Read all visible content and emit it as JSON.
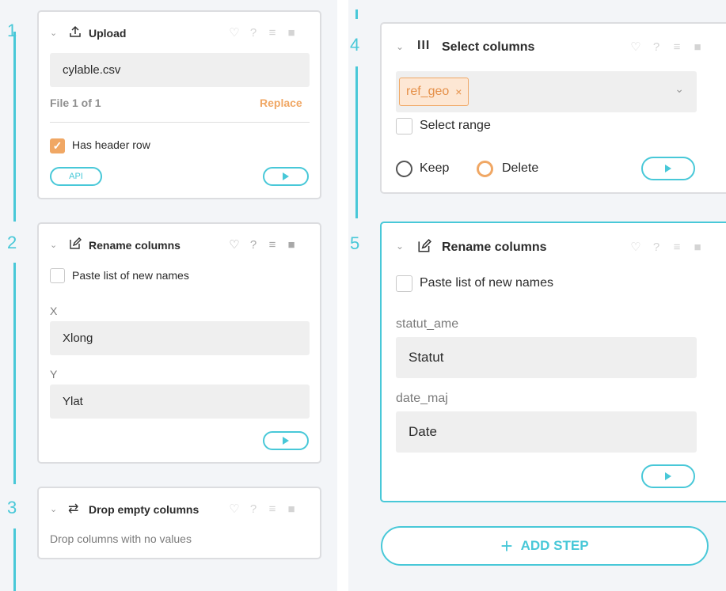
{
  "steps": {
    "upload": {
      "number": "1",
      "title": "Upload",
      "filename": "cylable.csv",
      "file_count": "File 1 of 1",
      "replace_label": "Replace",
      "header_row_label": "Has header row",
      "header_row_checked": true,
      "api_label": "API"
    },
    "rename_left": {
      "number": "2",
      "title": "Rename columns",
      "paste_label": "Paste list of new names",
      "fields": [
        {
          "column": "X",
          "value": "Xlong"
        },
        {
          "column": "Y",
          "value": "Ylat"
        }
      ]
    },
    "drop_empty": {
      "number": "3",
      "title": "Drop empty columns",
      "description": "Drop columns with no values"
    },
    "select_columns": {
      "number": "4",
      "title": "Select columns",
      "selected_tag": "ref_geo",
      "tag_remove": "×",
      "select_range_label": "Select range",
      "keep_label": "Keep",
      "delete_label": "Delete",
      "selected_mode": "Delete"
    },
    "rename_right": {
      "number": "5",
      "title": "Rename columns",
      "paste_label": "Paste list of new names",
      "fields": [
        {
          "column": "statut_ame",
          "value": "Statut"
        },
        {
          "column": "date_maj",
          "value": "Date"
        }
      ]
    }
  },
  "add_step_label": "ADD STEP",
  "icons": {
    "chevron": "chevron-down-icon",
    "upload": "upload-icon",
    "rename": "edit-icon",
    "drop": "swap-arrows-icon",
    "select": "columns-icon",
    "bell": "bell-icon",
    "help": "help-icon",
    "add_note": "add-note-icon",
    "delete": "trash-icon",
    "play": "play-icon"
  },
  "colors": {
    "accent": "#48c8d8",
    "orange": "#f0a764",
    "panel_bg": "#f3f5f8"
  }
}
